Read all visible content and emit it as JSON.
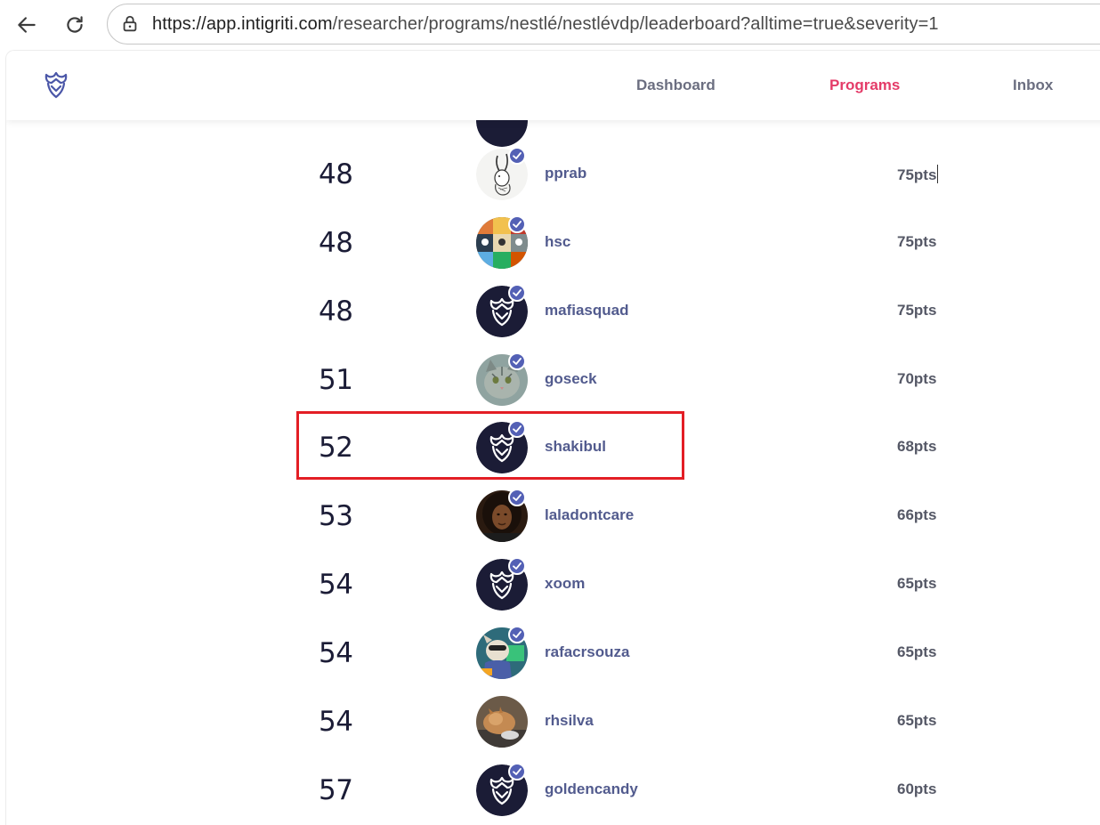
{
  "browser": {
    "url_host": "https://app.intigriti.com",
    "url_path": "/researcher/programs/nestlé/nestlévdp/leaderboard?alltime=true&severity=1"
  },
  "header": {
    "logo": "intigriti-logo-icon",
    "nav": [
      {
        "label": "Dashboard",
        "active": false
      },
      {
        "label": "Programs",
        "active": true
      },
      {
        "label": "Inbox",
        "active": false
      }
    ]
  },
  "leaderboard": {
    "rows": [
      {
        "rank": "48",
        "username": "pprab",
        "points": "75pts",
        "avatar": "rabbit-sketch"
      },
      {
        "rank": "48",
        "username": "hsc",
        "points": "75pts",
        "avatar": "pixel-grid"
      },
      {
        "rank": "48",
        "username": "mafiasquad",
        "points": "75pts",
        "avatar": "default-logo"
      },
      {
        "rank": "51",
        "username": "goseck",
        "points": "70pts",
        "avatar": "cat-photo"
      },
      {
        "rank": "52",
        "username": "shakibul",
        "points": "68pts",
        "avatar": "default-logo",
        "highlighted": true
      },
      {
        "rank": "53",
        "username": "laladontcare",
        "points": "66pts",
        "avatar": "portrait-photo"
      },
      {
        "rank": "54",
        "username": "xoom",
        "points": "65pts",
        "avatar": "default-logo"
      },
      {
        "rank": "54",
        "username": "rafacrsouza",
        "points": "65pts",
        "avatar": "cartoon-dog"
      },
      {
        "rank": "54",
        "username": "rhsilva",
        "points": "65pts",
        "avatar": "cat-sleeping-photo"
      },
      {
        "rank": "57",
        "username": "goldencandy",
        "points": "60pts",
        "avatar": "default-logo"
      }
    ]
  },
  "colors": {
    "accent": "#e43b68",
    "navy": "#1b1c36",
    "username": "#525b8e",
    "verified": "#5360b5",
    "highlight": "#e31e25"
  }
}
